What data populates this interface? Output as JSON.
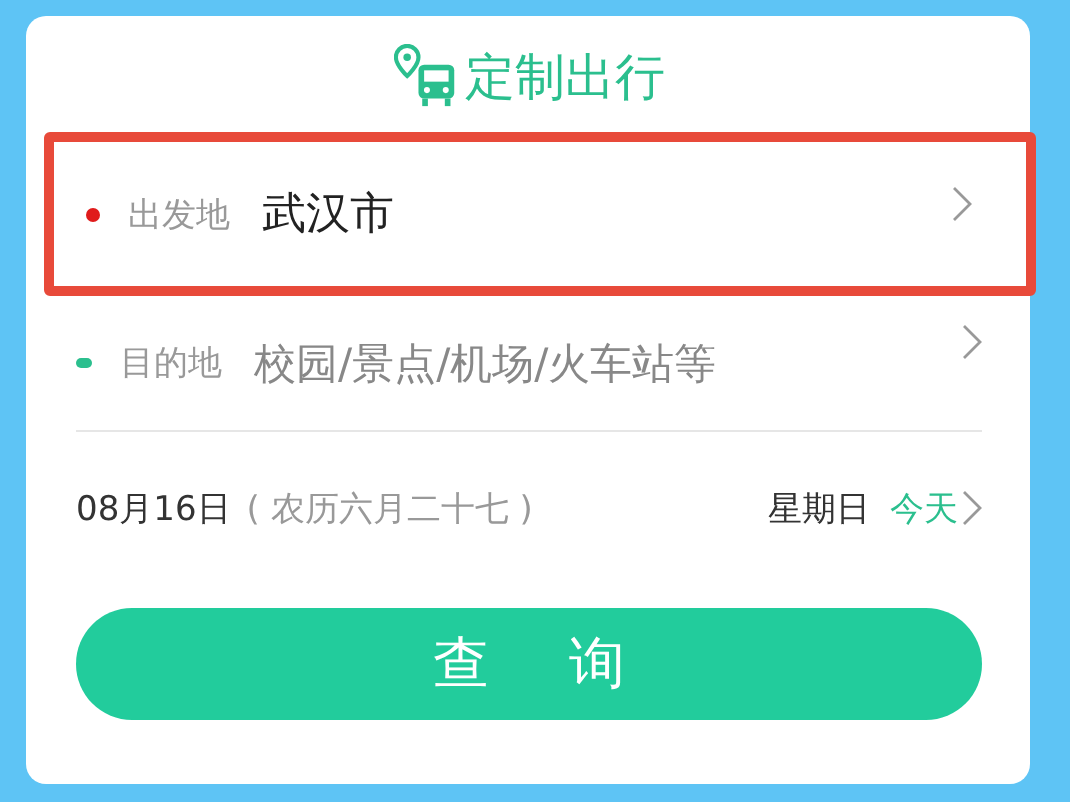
{
  "title": "定制出行",
  "places": [
    {
      "label": "出发地",
      "value": "武汉市",
      "color": "#e01b1b",
      "highlighted": true
    },
    {
      "label": "目的地",
      "placeholder": "校园/景点/机场/火车站等",
      "color": "#2bbf8e",
      "highlighted": false
    }
  ],
  "date": {
    "date": "08月16日",
    "lunar": "( 农历六月二十七 )",
    "weekday": "星期日",
    "relative": "今天"
  },
  "search_button": "查询"
}
